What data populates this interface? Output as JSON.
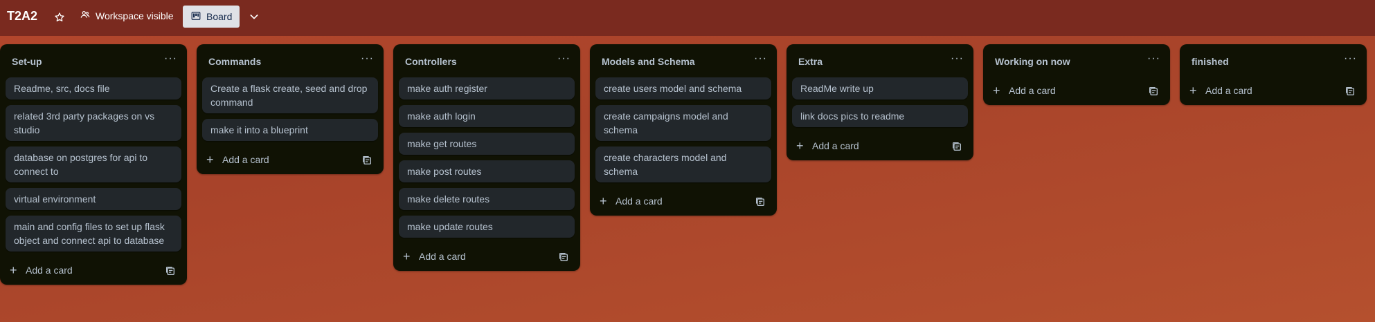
{
  "header": {
    "board_title": "T2A2",
    "star_icon": "star-icon",
    "visibility_label": "Workspace visible",
    "visibility_icon": "people-icon",
    "view_label": "Board",
    "view_icon": "board-icon",
    "view_chevron": "chevron-down-icon"
  },
  "lists": [
    {
      "title": "Set-up",
      "cards": [
        "Readme, src, docs file",
        "related 3rd party packages on vs studio",
        "database on postgres for api to connect to",
        "virtual environment",
        "main and config files to set up flask object and connect api to database"
      ],
      "add_label": "Add a card"
    },
    {
      "title": "Commands",
      "cards": [
        "Create a flask create, seed and drop command",
        "make it into a blueprint"
      ],
      "add_label": "Add a card"
    },
    {
      "title": "Controllers",
      "cards": [
        "make auth register",
        "make auth login",
        "make get routes",
        "make post routes",
        "make delete routes",
        "make update routes"
      ],
      "add_label": "Add a card"
    },
    {
      "title": "Models and Schema",
      "cards": [
        "create users model and schema",
        "create campaigns model and schema",
        "create characters model and schema"
      ],
      "add_label": "Add a card"
    },
    {
      "title": "Extra",
      "cards": [
        "ReadMe write up",
        "link docs pics to readme"
      ],
      "add_label": "Add a card"
    },
    {
      "title": "Working on now",
      "cards": [],
      "add_label": "Add a card"
    },
    {
      "title": "finished",
      "cards": [],
      "add_label": "Add a card"
    }
  ],
  "colors": {
    "topbar": "#7a2a1f",
    "list_bg": "#101204",
    "card_bg": "#22272b",
    "text": "#b6c2cf"
  }
}
